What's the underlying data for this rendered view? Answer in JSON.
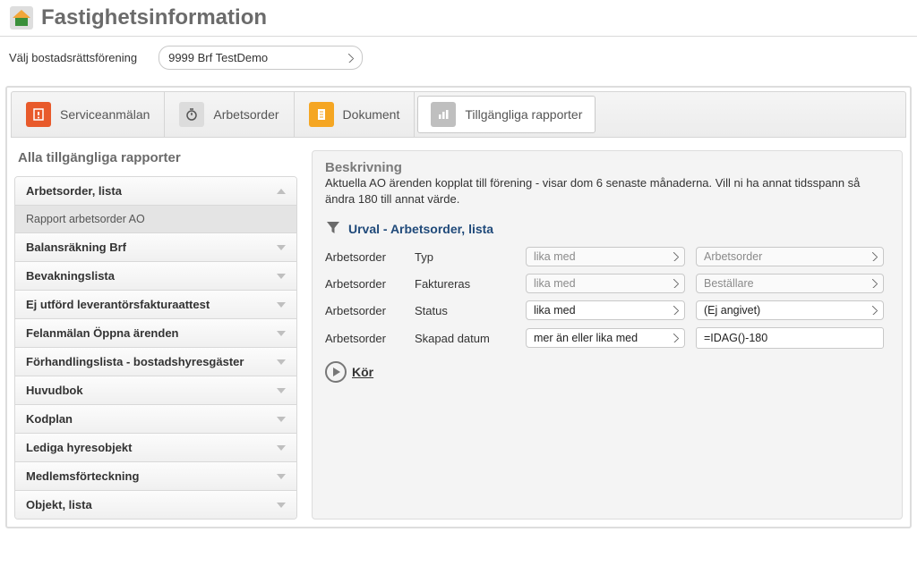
{
  "header": {
    "title": "Fastighetsinformation"
  },
  "selector": {
    "label": "Välj bostadsrättsförening",
    "value": "9999 Brf TestDemo"
  },
  "tabs": [
    {
      "label": "Serviceanmälan"
    },
    {
      "label": "Arbetsorder"
    },
    {
      "label": "Dokument"
    },
    {
      "label": "Tillgängliga rapporter"
    }
  ],
  "sidebar": {
    "heading": "Alla tillgängliga rapporter",
    "expanded": {
      "label": "Arbetsorder, lista",
      "sub": "Rapport arbetsorder AO"
    },
    "items": [
      "Balansräkning Brf",
      "Bevakningslista",
      "Ej utförd leverantörsfakturaattest",
      "Felanmälan Öppna ärenden",
      "Förhandlingslista - bostadshyresgäster",
      "Huvudbok",
      "Kodplan",
      "Lediga hyresobjekt",
      "Medlemsförteckning",
      "Objekt, lista"
    ]
  },
  "detail": {
    "beskrivning_label": "Beskrivning",
    "beskrivning_text": "Aktuella AO ärenden kopplat till förening - visar dom 6 senaste månaderna. Vill ni ha annat tidsspann så ändra 180 till annat värde.",
    "urval_title": "Urval - Arbetsorder, lista",
    "filters": [
      {
        "col1": "Arbetsorder",
        "col2": "Typ",
        "op": "lika med",
        "val": "Arbetsorder",
        "val_type": "select",
        "op_enabled": false,
        "val_enabled": false
      },
      {
        "col1": "Arbetsorder",
        "col2": "Faktureras",
        "op": "lika med",
        "val": "Beställare",
        "val_type": "select",
        "op_enabled": false,
        "val_enabled": false
      },
      {
        "col1": "Arbetsorder",
        "col2": "Status",
        "op": "lika med",
        "val": "(Ej angivet)",
        "val_type": "select",
        "op_enabled": true,
        "val_enabled": true
      },
      {
        "col1": "Arbetsorder",
        "col2": "Skapad datum",
        "op": "mer än eller lika med",
        "val": "=IDAG()-180",
        "val_type": "text",
        "op_enabled": true,
        "val_enabled": true
      }
    ],
    "run_label": "Kör"
  }
}
